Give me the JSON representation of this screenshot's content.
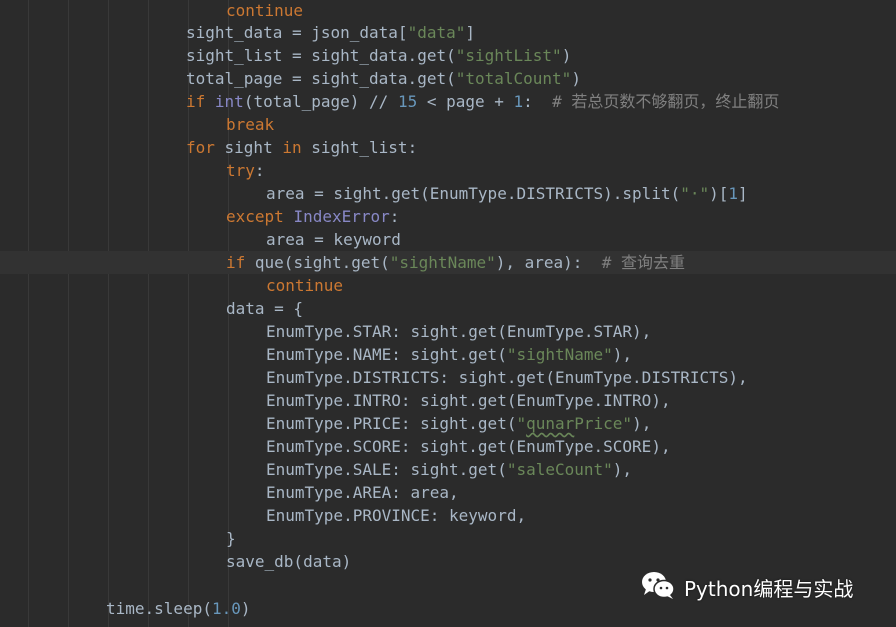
{
  "colors": {
    "background": "#2b2b2b",
    "default_text": "#a9b7c6",
    "keyword": "#cc7832",
    "string": "#6a8759",
    "number": "#6897bb",
    "comment": "#808080",
    "builtin": "#8888c6"
  },
  "watermark": {
    "icon": "wechat-icon",
    "text": "Python编程与实战"
  },
  "code_lines": [
    [
      [
        "kw",
        "continue"
      ]
    ],
    [
      [
        "t",
        "sight_data = json_data["
      ],
      [
        "str",
        "\"data\""
      ],
      [
        "t",
        "]"
      ]
    ],
    [
      [
        "t",
        "sight_list = sight_data.get("
      ],
      [
        "str",
        "\"sightList\""
      ],
      [
        "t",
        ")"
      ]
    ],
    [
      [
        "t",
        "total_page = sight_data.get("
      ],
      [
        "str",
        "\"totalCount\""
      ],
      [
        "t",
        ")"
      ]
    ],
    [
      [
        "kw",
        "if "
      ],
      [
        "builtin",
        "int"
      ],
      [
        "t",
        "(total_page) // "
      ],
      [
        "num",
        "15"
      ],
      [
        "t",
        " < page + "
      ],
      [
        "num",
        "1"
      ],
      [
        "t",
        ":  "
      ],
      [
        "cmt",
        "# 若总页数不够翻页，终止翻页"
      ]
    ],
    [
      [
        "kw",
        "break"
      ]
    ],
    [
      [
        "kw",
        "for "
      ],
      [
        "t",
        "sight "
      ],
      [
        "kw",
        "in "
      ],
      [
        "t",
        "sight_list:"
      ]
    ],
    [
      [
        "kw",
        "try"
      ],
      [
        "t",
        ":"
      ]
    ],
    [
      [
        "t",
        "area = sight.get(EnumType.DISTRICTS).split("
      ],
      [
        "str",
        "\"·\""
      ],
      [
        "t",
        ")["
      ],
      [
        "num",
        "1"
      ],
      [
        "t",
        "]"
      ]
    ],
    [
      [
        "kw",
        "except "
      ],
      [
        "cls",
        "IndexError"
      ],
      [
        "t",
        ":"
      ]
    ],
    [
      [
        "t",
        "area = keyword"
      ]
    ],
    [
      [
        "kw",
        "if "
      ],
      [
        "t",
        "que(sight.get("
      ],
      [
        "str",
        "\"sightName\""
      ],
      [
        "t",
        "), area):  "
      ],
      [
        "cmt",
        "# 查询去重"
      ]
    ],
    [
      [
        "kw",
        "continue"
      ]
    ],
    [
      [
        "t",
        "data = {"
      ]
    ],
    [
      [
        "t",
        "EnumType.STAR: sight.get(EnumType.STAR),"
      ]
    ],
    [
      [
        "t",
        "EnumType.NAME: sight.get("
      ],
      [
        "str",
        "\"sightName\""
      ],
      [
        "t",
        "),"
      ]
    ],
    [
      [
        "t",
        "EnumType.DISTRICTS: sight.get(EnumType.DISTRICTS),"
      ]
    ],
    [
      [
        "t",
        "EnumType.INTRO: sight.get(EnumType.INTRO),"
      ]
    ],
    [
      [
        "t",
        "EnumType.PRICE: sight.get("
      ],
      [
        "str",
        "\""
      ],
      [
        "sq",
        "qunar"
      ],
      [
        "str",
        "Price\""
      ],
      [
        "t",
        "),"
      ]
    ],
    [
      [
        "t",
        "EnumType.SCORE: sight.get(EnumType.SCORE),"
      ]
    ],
    [
      [
        "t",
        "EnumType.SALE: sight.get("
      ],
      [
        "str",
        "\"saleCount\""
      ],
      [
        "t",
        "),"
      ]
    ],
    [
      [
        "t",
        "EnumType.AREA: area,"
      ]
    ],
    [
      [
        "t",
        "EnumType.PROVINCE: keyword,"
      ]
    ],
    [
      [
        "t",
        "}"
      ]
    ],
    [
      [
        "t",
        "save_db(data)"
      ]
    ],
    [
      [
        "t",
        ""
      ]
    ],
    [
      [
        "t",
        "time.sleep("
      ],
      [
        "num",
        "1.0"
      ],
      [
        "t",
        ")"
      ]
    ]
  ]
}
